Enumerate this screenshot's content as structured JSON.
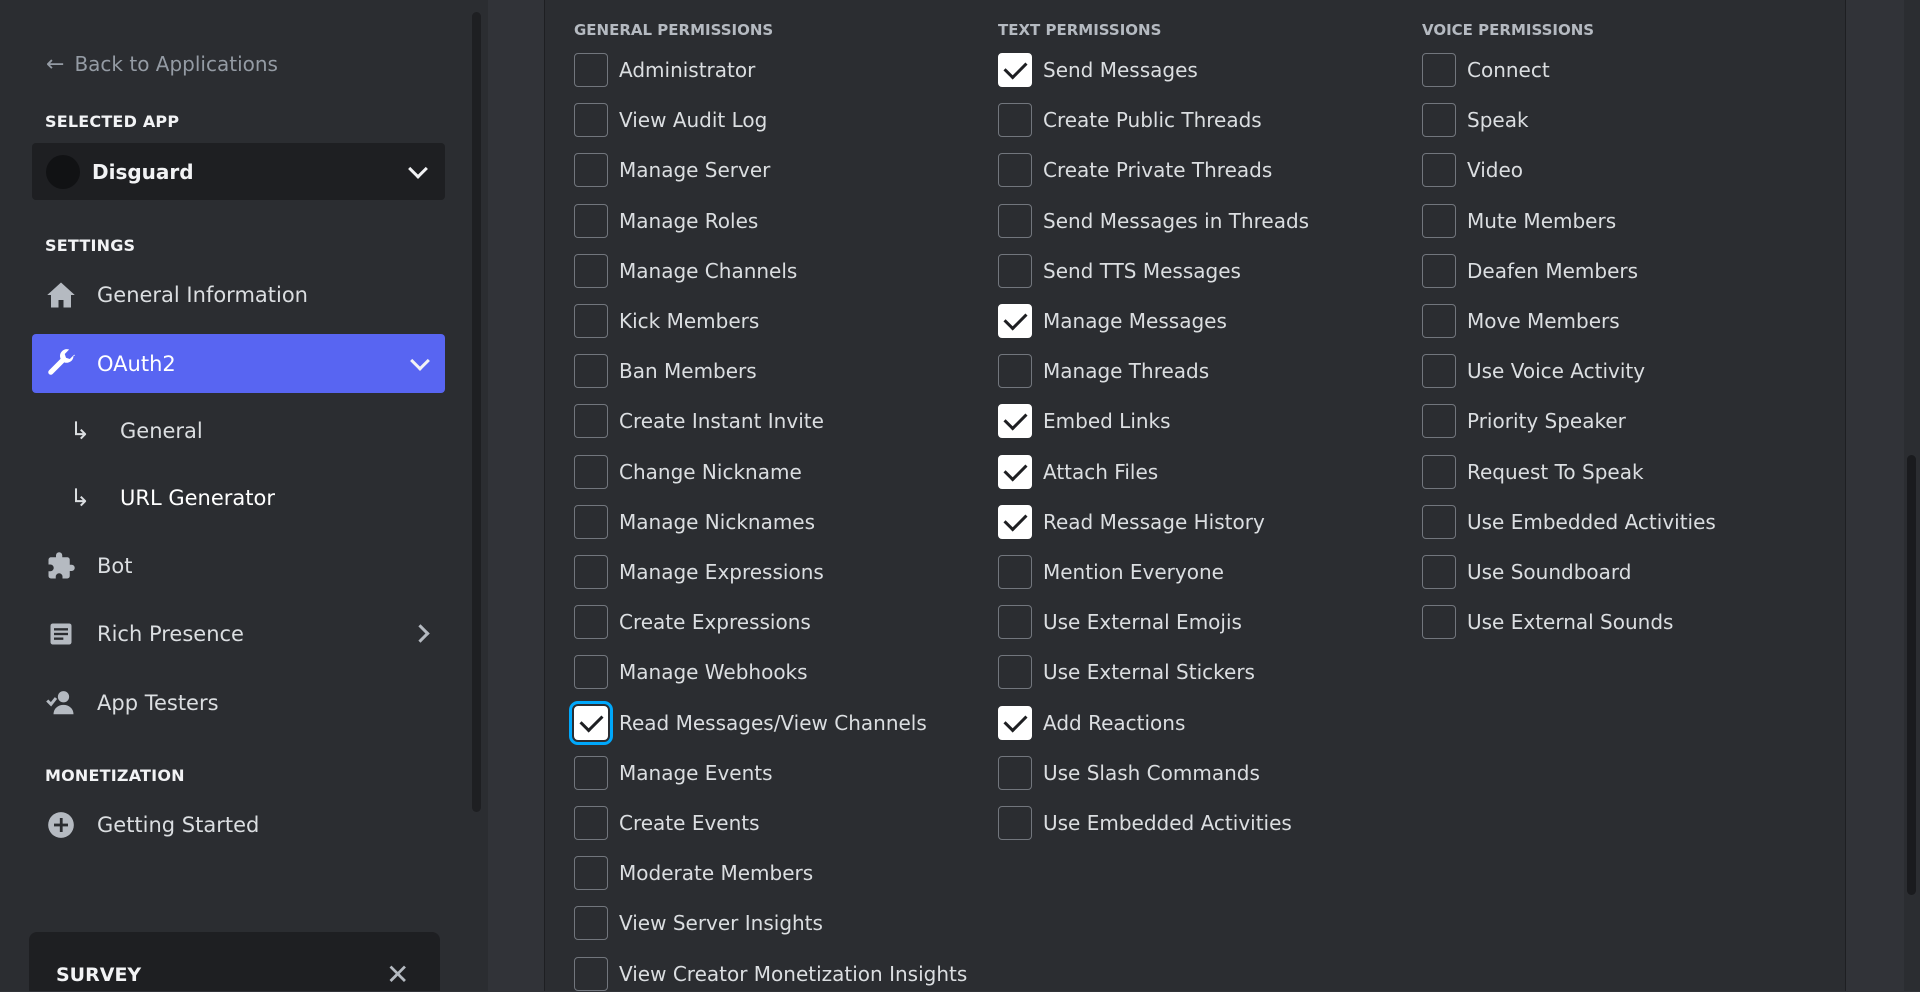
{
  "sidebar": {
    "back_label": "Back to Applications",
    "selected_app_heading": "SELECTED APP",
    "app_name": "Disguard",
    "settings_heading": "SETTINGS",
    "nav": {
      "general_information": "General Information",
      "oauth2": "OAuth2",
      "oauth2_general": "General",
      "url_generator": "URL Generator",
      "bot": "Bot",
      "rich_presence": "Rich Presence",
      "app_testers": "App Testers"
    },
    "monetization_heading": "MONETIZATION",
    "getting_started": "Getting Started",
    "survey_title": "SURVEY"
  },
  "permissions": {
    "general": {
      "heading": "GENERAL PERMISSIONS",
      "items": [
        {
          "label": "Administrator",
          "checked": false
        },
        {
          "label": "View Audit Log",
          "checked": false
        },
        {
          "label": "Manage Server",
          "checked": false
        },
        {
          "label": "Manage Roles",
          "checked": false
        },
        {
          "label": "Manage Channels",
          "checked": false
        },
        {
          "label": "Kick Members",
          "checked": false
        },
        {
          "label": "Ban Members",
          "checked": false
        },
        {
          "label": "Create Instant Invite",
          "checked": false
        },
        {
          "label": "Change Nickname",
          "checked": false
        },
        {
          "label": "Manage Nicknames",
          "checked": false
        },
        {
          "label": "Manage Expressions",
          "checked": false
        },
        {
          "label": "Create Expressions",
          "checked": false
        },
        {
          "label": "Manage Webhooks",
          "checked": false
        },
        {
          "label": "Read Messages/View Channels",
          "checked": true,
          "focused": true
        },
        {
          "label": "Manage Events",
          "checked": false
        },
        {
          "label": "Create Events",
          "checked": false
        },
        {
          "label": "Moderate Members",
          "checked": false
        },
        {
          "label": "View Server Insights",
          "checked": false
        },
        {
          "label": "View Creator Monetization Insights",
          "checked": false
        }
      ]
    },
    "text": {
      "heading": "TEXT PERMISSIONS",
      "items": [
        {
          "label": "Send Messages",
          "checked": true
        },
        {
          "label": "Create Public Threads",
          "checked": false
        },
        {
          "label": "Create Private Threads",
          "checked": false
        },
        {
          "label": "Send Messages in Threads",
          "checked": false
        },
        {
          "label": "Send TTS Messages",
          "checked": false
        },
        {
          "label": "Manage Messages",
          "checked": true
        },
        {
          "label": "Manage Threads",
          "checked": false
        },
        {
          "label": "Embed Links",
          "checked": true
        },
        {
          "label": "Attach Files",
          "checked": true
        },
        {
          "label": "Read Message History",
          "checked": true
        },
        {
          "label": "Mention Everyone",
          "checked": false
        },
        {
          "label": "Use External Emojis",
          "checked": false
        },
        {
          "label": "Use External Stickers",
          "checked": false
        },
        {
          "label": "Add Reactions",
          "checked": true
        },
        {
          "label": "Use Slash Commands",
          "checked": false
        },
        {
          "label": "Use Embedded Activities",
          "checked": false
        }
      ]
    },
    "voice": {
      "heading": "VOICE PERMISSIONS",
      "items": [
        {
          "label": "Connect",
          "checked": false
        },
        {
          "label": "Speak",
          "checked": false
        },
        {
          "label": "Video",
          "checked": false
        },
        {
          "label": "Mute Members",
          "checked": false
        },
        {
          "label": "Deafen Members",
          "checked": false
        },
        {
          "label": "Move Members",
          "checked": false
        },
        {
          "label": "Use Voice Activity",
          "checked": false
        },
        {
          "label": "Priority Speaker",
          "checked": false
        },
        {
          "label": "Request To Speak",
          "checked": false
        },
        {
          "label": "Use Embedded Activities",
          "checked": false
        },
        {
          "label": "Use Soundboard",
          "checked": false
        },
        {
          "label": "Use External Sounds",
          "checked": false
        }
      ]
    }
  },
  "colors": {
    "accent": "#5865f2",
    "focus_ring": "#00a8fc",
    "sidebar_bg": "#2b2d31",
    "main_bg": "#313338"
  }
}
